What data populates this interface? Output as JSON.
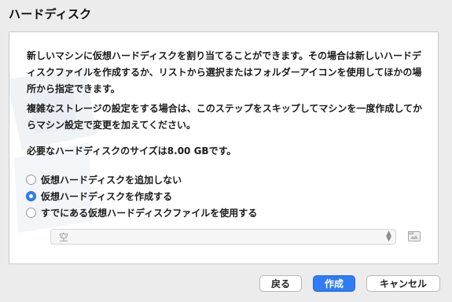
{
  "window": {
    "title": "ハードディスク"
  },
  "description": {
    "paragraph1": "新しいマシンに仮想ハードディスクを割り当てることができます。その場合は新しいハードディスクファイルを作成するか、リストから選択またはフォルダーアイコンを使用してほかの場所から指定できます。",
    "paragraph2": "複雑なストレージの設定をする場合は、このステップをスキップしてマシンを一度作成してからマシン設定で変更を加えてください。",
    "paragraph3": "必要なハードディスクのサイズは8.00 GBです。"
  },
  "options": [
    {
      "label": "仮想ハードディスクを追加しない",
      "selected": false
    },
    {
      "label": "仮想ハードディスクを作成する",
      "selected": true
    },
    {
      "label": "すでにある仮想ハードディスクファイルを使用する",
      "selected": false
    }
  ],
  "disk_select": {
    "value": "空",
    "enabled": false
  },
  "buttons": {
    "back": "戻る",
    "create": "作成",
    "cancel": "キャンセル"
  },
  "colors": {
    "accent": "#2f7cf6",
    "background": "#ececec",
    "panel": "#ffffff"
  },
  "icons": {
    "folder": "folder-open-icon",
    "watermark": "virtualbox-watermark"
  }
}
